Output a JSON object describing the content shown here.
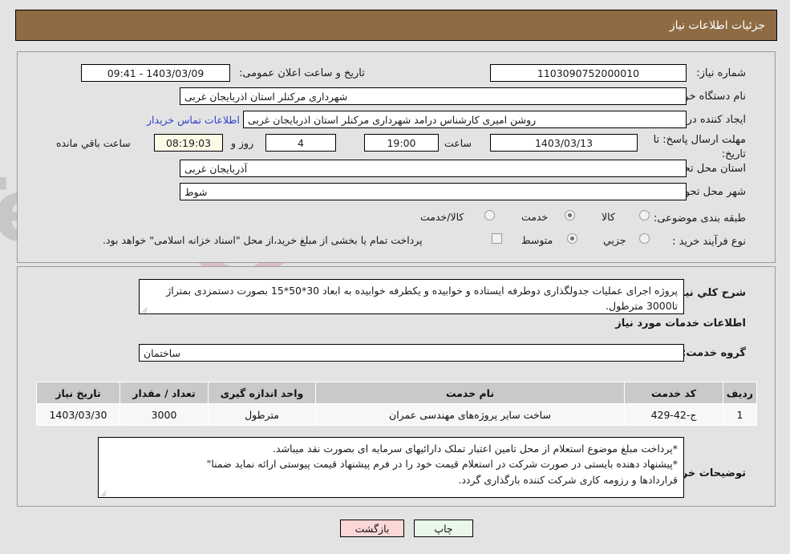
{
  "header": {
    "title": "جزئیات اطلاعات نیاز"
  },
  "form": {
    "need_number": {
      "label": "شماره نیاز:",
      "value": "1103090752000010"
    },
    "announce_datetime": {
      "label": "تاریخ و ساعت اعلان عمومی:",
      "value": "1403/03/09 - 09:41"
    },
    "buyer_org": {
      "label": "نام دستگاه خریدار:",
      "value": "شهرداری مرکنلر استان اذربایجان غربی"
    },
    "requester": {
      "label": "ایجاد کننده درخواست:",
      "value": "روشن امیری کارشناس درامد شهرداری مرکنلر استان اذربایجان غربی"
    },
    "contact_link": "اطلاعات تماس خریدار",
    "deadline": {
      "label": "مهلت ارسال پاسخ: تا تاریخ:",
      "date": "1403/03/13",
      "time_label": "ساعت",
      "time": "19:00",
      "days": "4",
      "days_label": "روز و",
      "remaining": "08:19:03",
      "remaining_label": "ساعت باقي مانده"
    },
    "delivery_province": {
      "label": "استان محل تحویل:",
      "value": "آذربایجان غربی"
    },
    "delivery_city": {
      "label": "شهر محل تحویل:",
      "value": "شوط"
    },
    "category": {
      "label": "طبقه بندی موضوعی:",
      "options": [
        "کالا",
        "خدمت",
        "کالا/خدمت"
      ],
      "selected_index": 1
    },
    "purchase_type": {
      "label": "نوع فرآیند خرید :",
      "options": [
        "جزیي",
        "متوسط"
      ],
      "selected_index": 1
    },
    "treasury_note": "پرداخت تمام یا بخشی از مبلغ خرید،از محل \"اسناد خزانه اسلامی\" خواهد بود.",
    "treasury_checked": false
  },
  "description": {
    "label": "شرح کلي نیاز:",
    "value": "پروژه اجرای عملیات جدولگذاری دوطرفه ایستاده و خوابیده و یکطرفه خوابیده به ابعاد 30*50*15 بصورت دستمزدی بمتراژ تا3000 مترطول."
  },
  "services_section": {
    "heading": "اطلاعات خدمات مورد نیاز",
    "service_group": {
      "label": "گروه خدمت:",
      "value": "ساختمان"
    },
    "table": {
      "columns": [
        "ردیف",
        "کد خدمت",
        "نام خدمت",
        "واحد اندازه گیری",
        "تعداد / مقدار",
        "تاریخ نیاز"
      ],
      "rows": [
        {
          "row": "1",
          "code": "ج-42-429",
          "name": "ساخت سایر پروژه‌های مهندسی عمران",
          "unit": "مترطول",
          "quantity": "3000",
          "need_date": "1403/03/30"
        }
      ]
    }
  },
  "buyer_notes": {
    "label": "توضیحات خریدار:",
    "lines": [
      "*پرداخت مبلغ موضوع استعلام از محل تامین اعتبار تملک دارائیهای سرمایه ای بصورت نقد میباشد.",
      "*پیشنهاد دهنده بایستی در  صورت شرکت در استعلام قیمت خود را در فرم پیشنهاد قیمت  پیوستی ارائه نماید ضمنا\"",
      "قراردادها و رزومه کاری شرکت کننده بارگذاری گردد."
    ]
  },
  "actions": {
    "print": "چاپ",
    "back": "بازگشت"
  },
  "colors": {
    "titlebar": "#8e6b43",
    "page_bg": "#e3e3e3",
    "link": "#2b3fcf",
    "table_header": "#c9c9c9",
    "print_btn": "#e9f7e9",
    "back_btn": "#fbd7d7"
  },
  "watermark": {
    "text": "AriaTender.net"
  }
}
